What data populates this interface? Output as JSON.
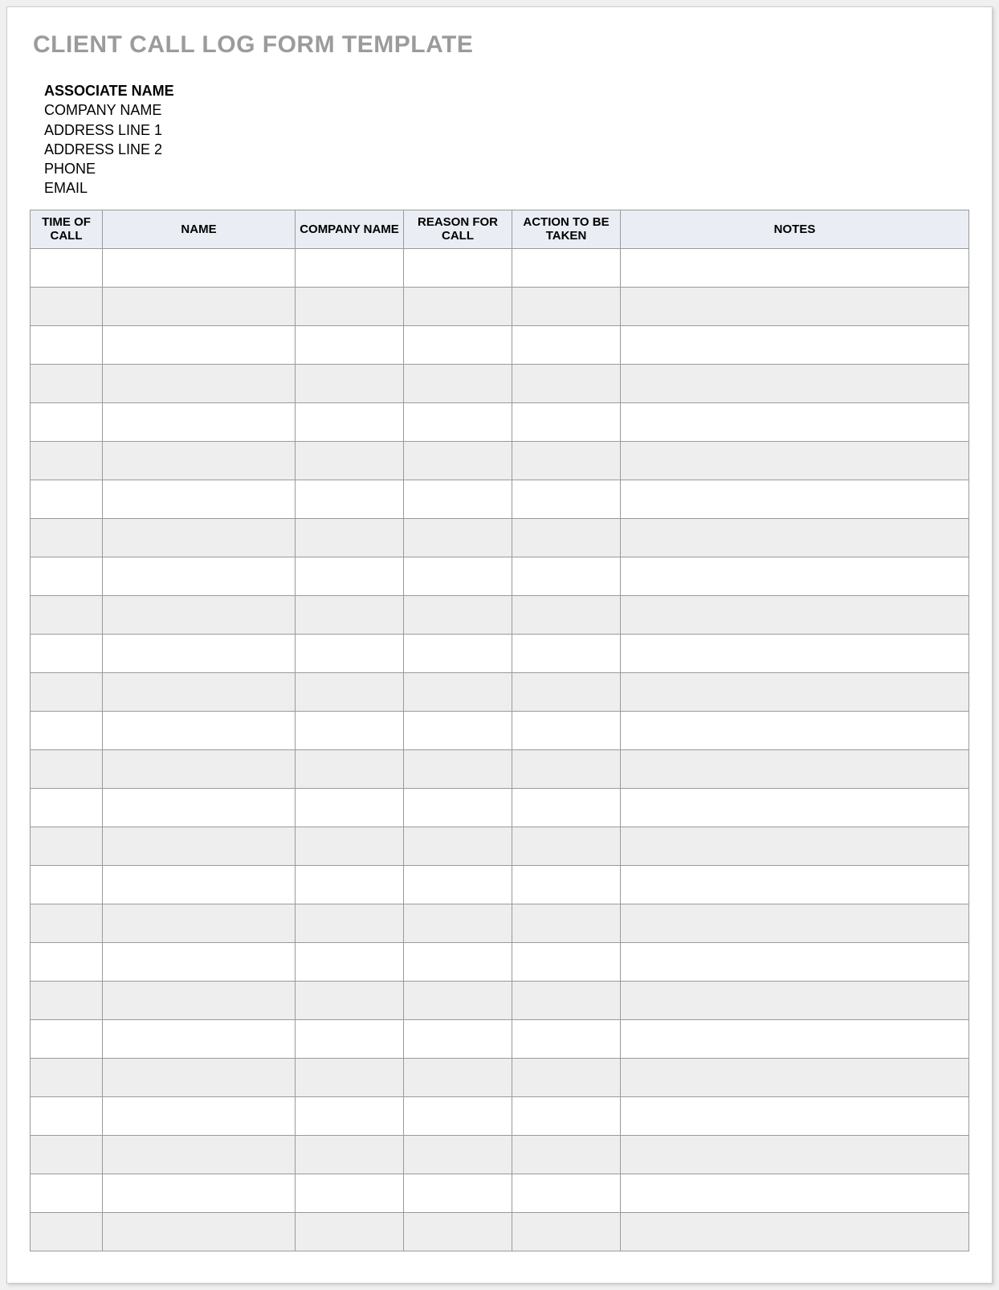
{
  "title": "CLIENT CALL LOG FORM TEMPLATE",
  "info": {
    "associate": "ASSOCIATE NAME",
    "company": "COMPANY NAME",
    "address1": "ADDRESS LINE 1",
    "address2": "ADDRESS LINE 2",
    "phone": "PHONE",
    "email": "EMAIL"
  },
  "table": {
    "headers": {
      "time": "TIME OF CALL",
      "name": "NAME",
      "company": "COMPANY NAME",
      "reason": "REASON FOR CALL",
      "action": "ACTION TO BE TAKEN",
      "notes": "NOTES"
    },
    "rows": [
      {
        "time": "",
        "name": "",
        "company": "",
        "reason": "",
        "action": "",
        "notes": ""
      },
      {
        "time": "",
        "name": "",
        "company": "",
        "reason": "",
        "action": "",
        "notes": ""
      },
      {
        "time": "",
        "name": "",
        "company": "",
        "reason": "",
        "action": "",
        "notes": ""
      },
      {
        "time": "",
        "name": "",
        "company": "",
        "reason": "",
        "action": "",
        "notes": ""
      },
      {
        "time": "",
        "name": "",
        "company": "",
        "reason": "",
        "action": "",
        "notes": ""
      },
      {
        "time": "",
        "name": "",
        "company": "",
        "reason": "",
        "action": "",
        "notes": ""
      },
      {
        "time": "",
        "name": "",
        "company": "",
        "reason": "",
        "action": "",
        "notes": ""
      },
      {
        "time": "",
        "name": "",
        "company": "",
        "reason": "",
        "action": "",
        "notes": ""
      },
      {
        "time": "",
        "name": "",
        "company": "",
        "reason": "",
        "action": "",
        "notes": ""
      },
      {
        "time": "",
        "name": "",
        "company": "",
        "reason": "",
        "action": "",
        "notes": ""
      },
      {
        "time": "",
        "name": "",
        "company": "",
        "reason": "",
        "action": "",
        "notes": ""
      },
      {
        "time": "",
        "name": "",
        "company": "",
        "reason": "",
        "action": "",
        "notes": ""
      },
      {
        "time": "",
        "name": "",
        "company": "",
        "reason": "",
        "action": "",
        "notes": ""
      },
      {
        "time": "",
        "name": "",
        "company": "",
        "reason": "",
        "action": "",
        "notes": ""
      },
      {
        "time": "",
        "name": "",
        "company": "",
        "reason": "",
        "action": "",
        "notes": ""
      },
      {
        "time": "",
        "name": "",
        "company": "",
        "reason": "",
        "action": "",
        "notes": ""
      },
      {
        "time": "",
        "name": "",
        "company": "",
        "reason": "",
        "action": "",
        "notes": ""
      },
      {
        "time": "",
        "name": "",
        "company": "",
        "reason": "",
        "action": "",
        "notes": ""
      },
      {
        "time": "",
        "name": "",
        "company": "",
        "reason": "",
        "action": "",
        "notes": ""
      },
      {
        "time": "",
        "name": "",
        "company": "",
        "reason": "",
        "action": "",
        "notes": ""
      },
      {
        "time": "",
        "name": "",
        "company": "",
        "reason": "",
        "action": "",
        "notes": ""
      },
      {
        "time": "",
        "name": "",
        "company": "",
        "reason": "",
        "action": "",
        "notes": ""
      },
      {
        "time": "",
        "name": "",
        "company": "",
        "reason": "",
        "action": "",
        "notes": ""
      },
      {
        "time": "",
        "name": "",
        "company": "",
        "reason": "",
        "action": "",
        "notes": ""
      },
      {
        "time": "",
        "name": "",
        "company": "",
        "reason": "",
        "action": "",
        "notes": ""
      },
      {
        "time": "",
        "name": "",
        "company": "",
        "reason": "",
        "action": "",
        "notes": ""
      }
    ]
  }
}
